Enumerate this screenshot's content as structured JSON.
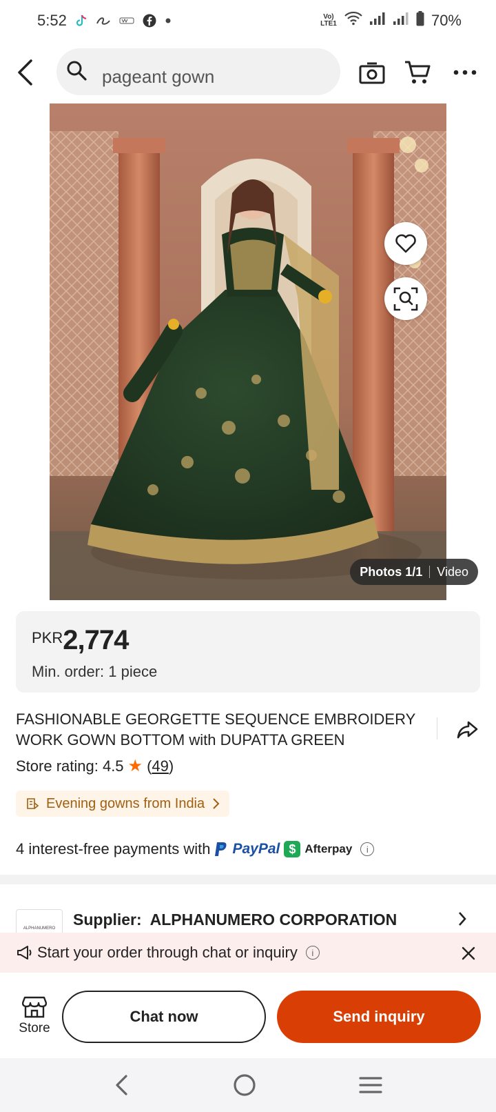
{
  "status_bar": {
    "time": "5:52",
    "battery": "70%",
    "network_label": "Vo) LTE1",
    "app_icons": [
      "tiktok-icon",
      "alibaba-icon",
      "wemu-icon",
      "facebook-icon",
      "dot-icon"
    ]
  },
  "header": {
    "search_text": "pageant gown"
  },
  "gallery": {
    "photos_label": "Photos 1/1",
    "video_label": "Video"
  },
  "price": {
    "currency": "PKR",
    "amount": "2,774",
    "min_order": "Min. order: 1 piece"
  },
  "product": {
    "title": "FASHIONABLE GEORGETTE SEQUENCE EMBROIDERY WORK GOWN BOTTOM with DUPATTA GREEN",
    "rating_label": "Store rating: 4.5",
    "review_count_open": "(",
    "review_count": "49",
    "review_count_close": ")",
    "category_chip": "Evening gowns from India"
  },
  "payments": {
    "text": "4 interest-free payments with",
    "paypal": "PayPal",
    "afterpay": "Afterpay"
  },
  "supplier": {
    "label": "Supplier:",
    "name": "ALPHANUMERO CORPORATION",
    "logo_text": "ALPHANUMERO"
  },
  "banner": {
    "text": "Start your order through chat or inquiry"
  },
  "actions": {
    "store": "Store",
    "chat": "Chat now",
    "inquiry": "Send inquiry"
  },
  "colors": {
    "accent": "#d93f05",
    "star": "#ff6a00",
    "chip_text": "#a15f0f"
  }
}
